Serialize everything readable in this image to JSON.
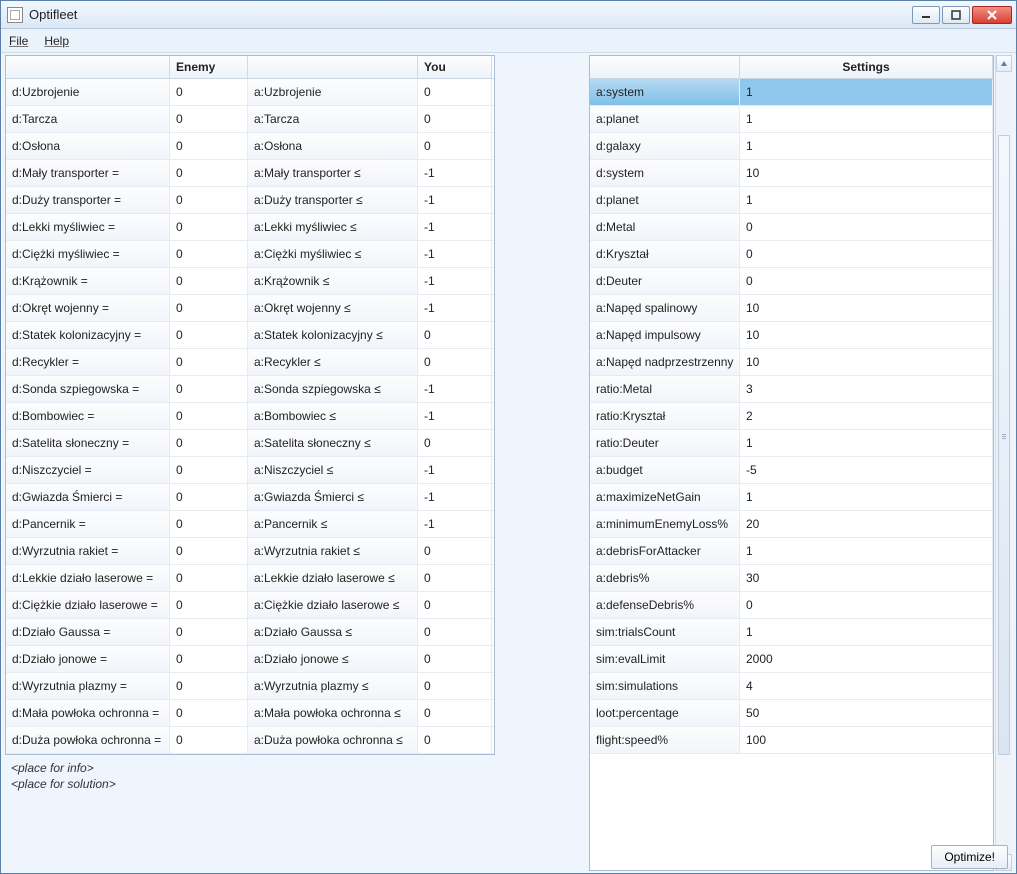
{
  "window": {
    "title": "Optifleet"
  },
  "menu": {
    "file": "File",
    "help": "Help"
  },
  "headers": {
    "enemy": "Enemy",
    "you": "You",
    "settings": "Settings"
  },
  "status": {
    "info": "<place for info>",
    "solution": "<place for solution>"
  },
  "buttons": {
    "optimize": "Optimize!"
  },
  "left_rows": [
    {
      "e": "d:Uzbrojenie",
      "ev": "0",
      "y": "a:Uzbrojenie",
      "yv": "0"
    },
    {
      "e": "d:Tarcza",
      "ev": "0",
      "y": "a:Tarcza",
      "yv": "0"
    },
    {
      "e": "d:Osłona",
      "ev": "0",
      "y": "a:Osłona",
      "yv": "0"
    },
    {
      "e": "d:Mały transporter =",
      "ev": "0",
      "y": "a:Mały transporter ≤",
      "yv": "-1"
    },
    {
      "e": "d:Duży transporter =",
      "ev": "0",
      "y": "a:Duży transporter ≤",
      "yv": "-1"
    },
    {
      "e": "d:Lekki myśliwiec =",
      "ev": "0",
      "y": "a:Lekki myśliwiec ≤",
      "yv": "-1"
    },
    {
      "e": "d:Ciężki myśliwiec =",
      "ev": "0",
      "y": "a:Ciężki myśliwiec ≤",
      "yv": "-1"
    },
    {
      "e": "d:Krążownik =",
      "ev": "0",
      "y": "a:Krążownik ≤",
      "yv": "-1"
    },
    {
      "e": "d:Okręt wojenny =",
      "ev": "0",
      "y": "a:Okręt wojenny ≤",
      "yv": "-1"
    },
    {
      "e": "d:Statek kolonizacyjny =",
      "ev": "0",
      "y": "a:Statek kolonizacyjny ≤",
      "yv": "0"
    },
    {
      "e": "d:Recykler =",
      "ev": "0",
      "y": "a:Recykler ≤",
      "yv": "0"
    },
    {
      "e": "d:Sonda szpiegowska =",
      "ev": "0",
      "y": "a:Sonda szpiegowska ≤",
      "yv": "-1"
    },
    {
      "e": "d:Bombowiec =",
      "ev": "0",
      "y": "a:Bombowiec ≤",
      "yv": "-1"
    },
    {
      "e": "d:Satelita słoneczny =",
      "ev": "0",
      "y": "a:Satelita słoneczny ≤",
      "yv": "0"
    },
    {
      "e": "d:Niszczyciel =",
      "ev": "0",
      "y": "a:Niszczyciel ≤",
      "yv": "-1"
    },
    {
      "e": "d:Gwiazda Śmierci =",
      "ev": "0",
      "y": "a:Gwiazda Śmierci ≤",
      "yv": "-1"
    },
    {
      "e": "d:Pancernik =",
      "ev": "0",
      "y": "a:Pancernik ≤",
      "yv": "-1"
    },
    {
      "e": "d:Wyrzutnia rakiet =",
      "ev": "0",
      "y": "a:Wyrzutnia rakiet ≤",
      "yv": "0"
    },
    {
      "e": "d:Lekkie działo laserowe =",
      "ev": "0",
      "y": "a:Lekkie działo laserowe ≤",
      "yv": "0"
    },
    {
      "e": "d:Ciężkie działo laserowe =",
      "ev": "0",
      "y": "a:Ciężkie działo laserowe ≤",
      "yv": "0"
    },
    {
      "e": "d:Działo Gaussa =",
      "ev": "0",
      "y": "a:Działo Gaussa ≤",
      "yv": "0"
    },
    {
      "e": "d:Działo jonowe =",
      "ev": "0",
      "y": "a:Działo jonowe ≤",
      "yv": "0"
    },
    {
      "e": "d:Wyrzutnia plazmy =",
      "ev": "0",
      "y": "a:Wyrzutnia plazmy ≤",
      "yv": "0"
    },
    {
      "e": "d:Mała powłoka ochronna =",
      "ev": "0",
      "y": "a:Mała powłoka ochronna ≤",
      "yv": "0"
    },
    {
      "e": "d:Duża powłoka ochronna =",
      "ev": "0",
      "y": "a:Duża powłoka ochronna ≤",
      "yv": "0"
    }
  ],
  "settings_rows": [
    {
      "k": "a:system",
      "v": "1",
      "sel": true
    },
    {
      "k": "a:planet",
      "v": "1"
    },
    {
      "k": "d:galaxy",
      "v": "1"
    },
    {
      "k": "d:system",
      "v": "10"
    },
    {
      "k": "d:planet",
      "v": "1"
    },
    {
      "k": "d:Metal",
      "v": "0"
    },
    {
      "k": "d:Kryształ",
      "v": "0"
    },
    {
      "k": "d:Deuter",
      "v": "0"
    },
    {
      "k": "a:Napęd spalinowy",
      "v": "10"
    },
    {
      "k": "a:Napęd impulsowy",
      "v": "10"
    },
    {
      "k": "a:Napęd nadprzestrzenny",
      "v": "10"
    },
    {
      "k": "ratio:Metal",
      "v": "3"
    },
    {
      "k": "ratio:Kryształ",
      "v": "2"
    },
    {
      "k": "ratio:Deuter",
      "v": "1"
    },
    {
      "k": "a:budget",
      "v": "-5"
    },
    {
      "k": "a:maximizeNetGain",
      "v": "1"
    },
    {
      "k": "a:minimumEnemyLoss%",
      "v": "20"
    },
    {
      "k": "a:debrisForAttacker",
      "v": "1"
    },
    {
      "k": "a:debris%",
      "v": "30"
    },
    {
      "k": "a:defenseDebris%",
      "v": "0"
    },
    {
      "k": "sim:trialsCount",
      "v": "1"
    },
    {
      "k": "sim:evalLimit",
      "v": "2000"
    },
    {
      "k": "sim:simulations",
      "v": "4"
    },
    {
      "k": "loot:percentage",
      "v": "50"
    },
    {
      "k": "flight:speed%",
      "v": "100"
    }
  ]
}
